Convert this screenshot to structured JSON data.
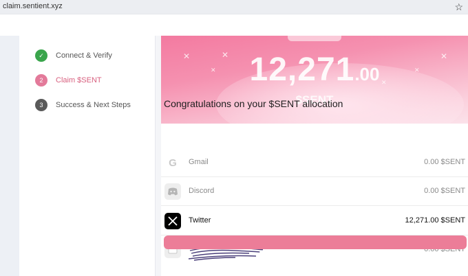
{
  "browser": {
    "url": "claim.sentient.xyz",
    "bookmark_icon": "star-icon"
  },
  "steps": [
    {
      "number": "✓",
      "label": "Connect & Verify",
      "state": "done"
    },
    {
      "number": "2",
      "label": "Claim $SENT",
      "state": "active"
    },
    {
      "number": "3",
      "label": "Success & Next Steps",
      "state": "todo"
    }
  ],
  "banner": {
    "amount_int": "12,271",
    "amount_dec": ".00",
    "currency": "$SENT"
  },
  "allocation": {
    "heading": "Congratulations on your $SENT allocation",
    "rows": [
      {
        "icon": "google-icon",
        "label": "Gmail",
        "value": "0.00 $SENT"
      },
      {
        "icon": "discord-icon",
        "label": "Discord",
        "value": "0.00 $SENT"
      },
      {
        "icon": "x-twitter-icon",
        "label": "Twitter",
        "value": "12,271.00 $SENT"
      },
      {
        "icon": "wallet-icon",
        "label": "",
        "value": "0.00 $SENT"
      }
    ]
  },
  "colors": {
    "accent_pink": "#ec7d98",
    "done_green": "#3aa54c",
    "active_pink": "#e37a9a"
  }
}
